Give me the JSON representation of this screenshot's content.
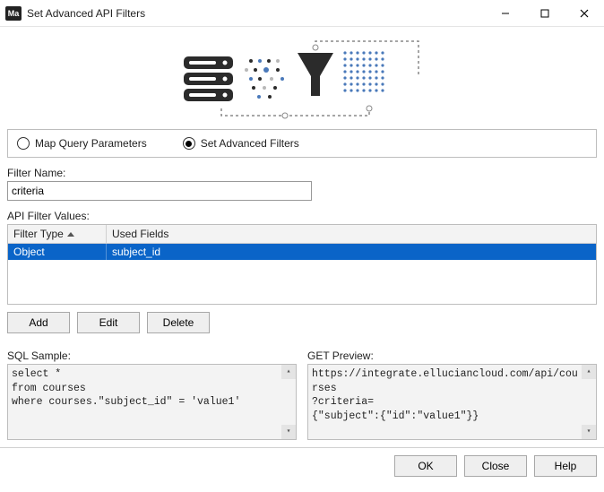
{
  "window": {
    "app_icon_text": "Ma",
    "title": "Set Advanced API Filters"
  },
  "mode": {
    "map_query": "Map Query Parameters",
    "set_advanced": "Set Advanced Filters",
    "selected": "set_advanced"
  },
  "filter_name": {
    "label": "Filter Name:",
    "value": "criteria"
  },
  "api_filter_values": {
    "label": "API Filter Values:",
    "columns": {
      "filter_type": "Filter Type",
      "used_fields": "Used Fields"
    },
    "rows": [
      {
        "filter_type": "Object",
        "used_fields": "subject_id"
      }
    ]
  },
  "buttons": {
    "add": "Add",
    "edit": "Edit",
    "delete": "Delete",
    "ok": "OK",
    "close": "Close",
    "help": "Help"
  },
  "sql_sample": {
    "label": "SQL Sample:",
    "text": "select *\nfrom courses\nwhere courses.\"subject_id\" = 'value1'"
  },
  "get_preview": {
    "label": "GET Preview:",
    "text": "https://integrate.elluciancloud.com/api/courses\n?criteria=\n{\"subject\":{\"id\":\"value1\"}}"
  }
}
